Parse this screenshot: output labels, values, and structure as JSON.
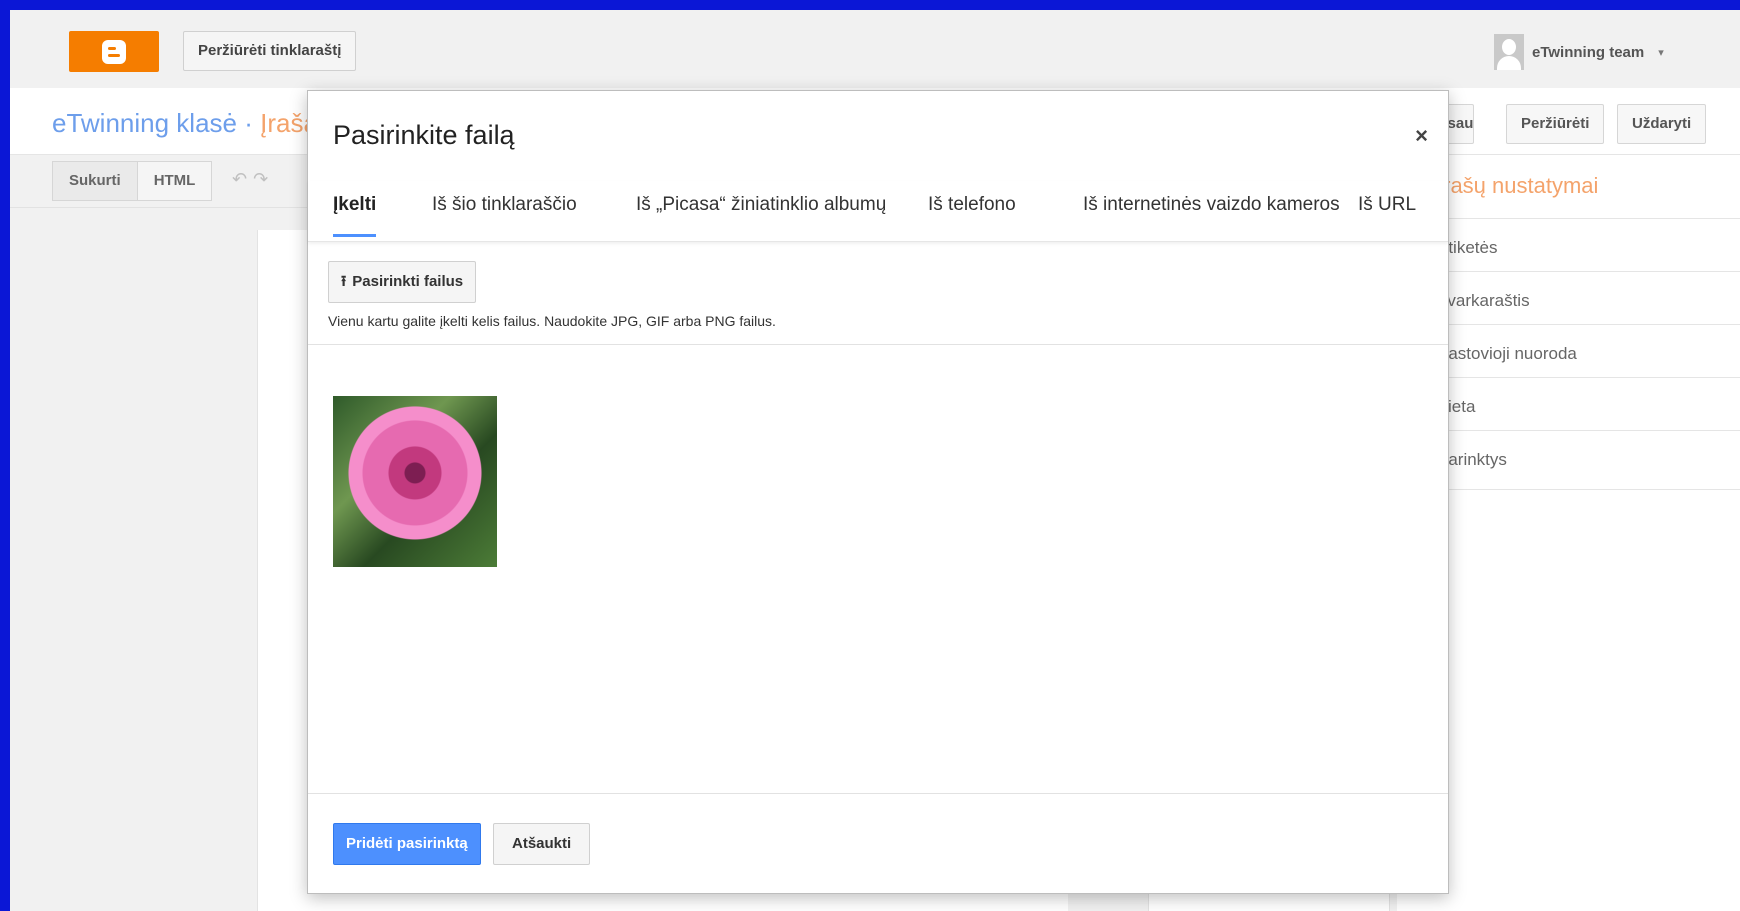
{
  "topbar": {
    "logo_icon": "blogger-logo-icon",
    "view_blog_label": "Peržiūrėti tinklaraštį",
    "user_name": "eTwinning team",
    "user_caret": "▾"
  },
  "editor": {
    "blog_title": "eTwinning klasė",
    "separator": " · ",
    "post_label": "Įrašas",
    "buttons": {
      "save": "Išsaugoti",
      "preview": "Peržiūrėti",
      "close": "Uždaryti"
    },
    "mode_tabs": [
      "Sukurti",
      "HTML"
    ]
  },
  "settings": {
    "title": "Įrašų nustatymai",
    "items": [
      "Etiketės",
      "Tvarkaraštis",
      "Pastovioji nuoroda",
      "Vieta",
      "Parinktys"
    ]
  },
  "modal": {
    "title": "Pasirinkite failą",
    "close_label": "×",
    "tabs": [
      "Įkelti",
      "Iš šio tinklaraščio",
      "Iš „Picasa“ žiniatinklio albumų",
      "Iš telefono",
      "Iš internetinės vaizdo kameros",
      "Iš URL"
    ],
    "active_tab_index": 0,
    "choose_files_label": "Pasirinkti failus",
    "upload_hint": "Vienu kartu galite įkelti kelis failus. Naudokite JPG, GIF arba PNG failus.",
    "add_selected_label": "Pridėti pasirinktą",
    "cancel_label": "Atšaukti"
  },
  "colors": {
    "accent_blue": "#4d90fe",
    "blogger_orange": "#f57d00",
    "title_blue": "#6d9eeb",
    "title_orange": "#f4a36b",
    "frame_blue": "#0b17d6"
  }
}
